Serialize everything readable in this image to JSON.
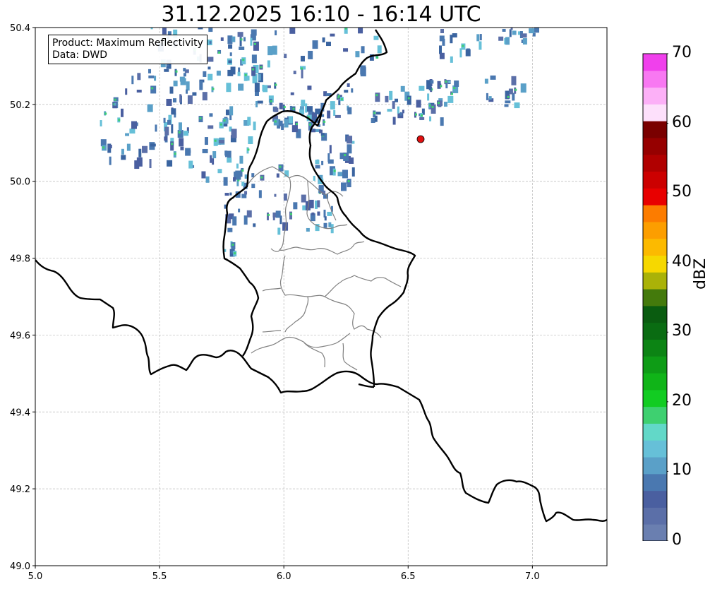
{
  "title": "31.12.2025 16:10 - 16:14 UTC",
  "info_box": {
    "product": "Product: Maximum Reflectivity",
    "data": "Data: DWD"
  },
  "axes": {
    "x_ticks": [
      "5.0",
      "5.5",
      "6.0",
      "6.5",
      "7.0"
    ],
    "y_ticks": [
      "50.4",
      "50.2",
      "50.0",
      "49.8",
      "49.6",
      "49.4",
      "49.2",
      "49.0"
    ],
    "xlim": [
      5.0,
      7.3
    ],
    "ylim": [
      49.0,
      50.4
    ],
    "grid": true
  },
  "colorbar": {
    "label": "dBZ",
    "ticks": [
      "70",
      "60",
      "50",
      "40",
      "30",
      "20",
      "10",
      "0"
    ],
    "range": [
      0,
      70
    ],
    "colors": [
      "#6a7fb0",
      "#5b6fa8",
      "#4a5fa0",
      "#4a78b0",
      "#5aa0c8",
      "#66c0d8",
      "#62d8c8",
      "#3ed070",
      "#12cc22",
      "#10b418",
      "#0e9c16",
      "#0c8414",
      "#0a6c12",
      "#0a5c10",
      "#447a0c",
      "#aab208",
      "#f6d800",
      "#fcba00",
      "#fc9e00",
      "#fc7c00",
      "#e80000",
      "#cc0000",
      "#b00000",
      "#960000",
      "#7a0000",
      "#fde0fb",
      "#fcb0f7",
      "#f878f2",
      "#f040ec"
    ]
  },
  "marker": {
    "label": "site-marker",
    "color": "#dd1111"
  }
}
